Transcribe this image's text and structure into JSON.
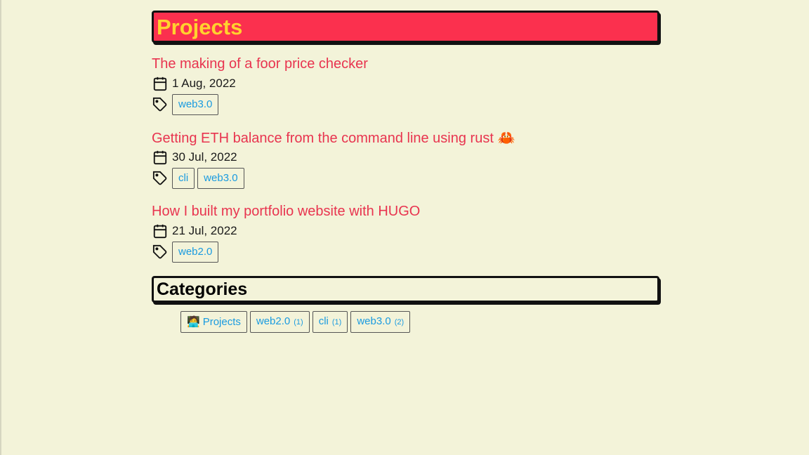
{
  "projects_section": {
    "title": "Projects"
  },
  "posts": [
    {
      "title": "The making of a foor price checker",
      "date": "1 Aug, 2022",
      "tags": [
        "web3.0"
      ]
    },
    {
      "title": "Getting ETH balance from the command line using rust",
      "title_emoji": "🦀",
      "date": "30 Jul, 2022",
      "tags": [
        "cli",
        "web3.0"
      ]
    },
    {
      "title": "How I built my portfolio website with HUGO",
      "date": "21 Jul, 2022",
      "tags": [
        "web2.0"
      ]
    }
  ],
  "categories_section": {
    "title": "Categories",
    "items": [
      {
        "emoji": "🧑‍💻",
        "label": "Projects",
        "count": ""
      },
      {
        "label": "web2.0",
        "count": "(1)"
      },
      {
        "label": "cli",
        "count": "(1)"
      },
      {
        "label": "web3.0",
        "count": "(2)"
      }
    ]
  },
  "colors": {
    "background": "#f3f3d9",
    "accent_red": "#fb304e",
    "title_yellow": "#ffd22e",
    "link_red": "#e8344f",
    "tag_blue": "#1a9be0"
  },
  "icons": {
    "date": "calendar-icon",
    "tags": "tag-icon"
  }
}
